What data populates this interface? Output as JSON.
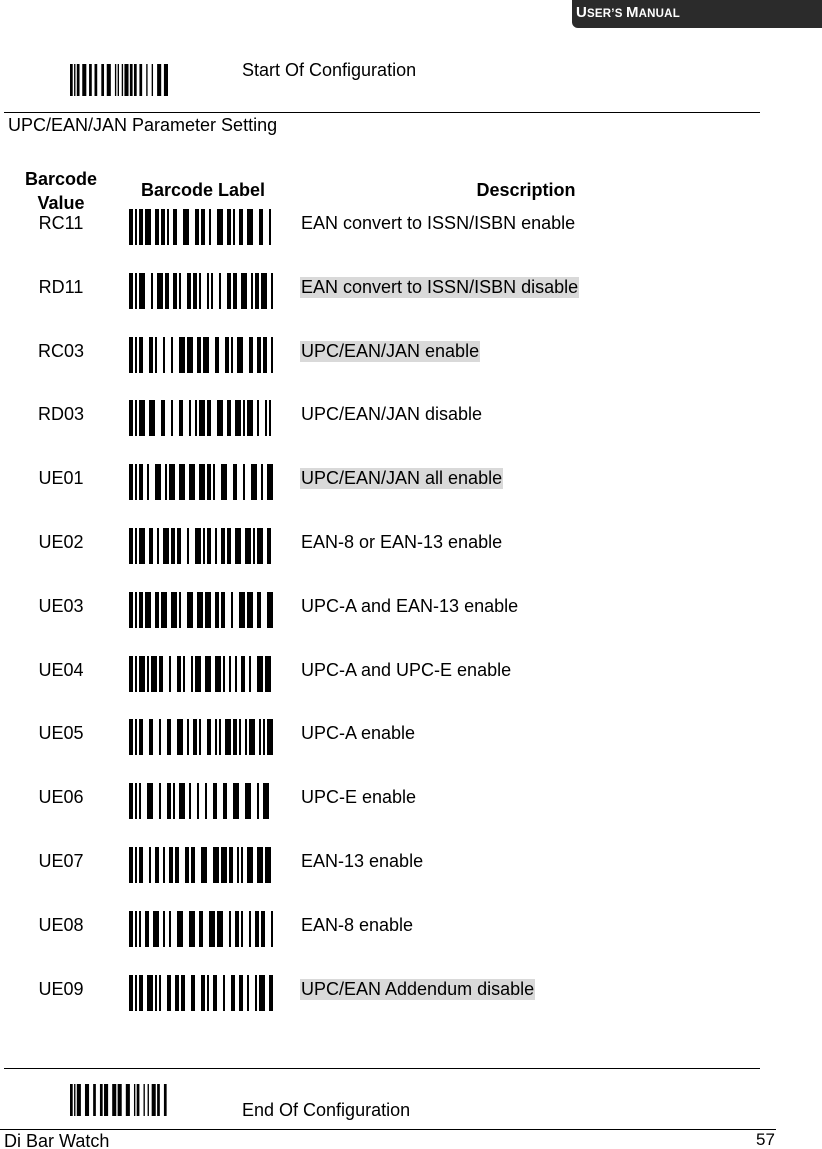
{
  "header": {
    "badge_first": "U",
    "badge_rest1": "SER’S ",
    "badge_first2": "M",
    "badge_rest2": "ANUAL"
  },
  "start_config": {
    "label": "Start Of Configuration",
    "icon": "barcode-icon"
  },
  "section_title": "UPC/EAN/JAN Parameter Setting",
  "table": {
    "headers": {
      "value_line1": "Barcode",
      "value_line2": "Value",
      "label": "Barcode Label",
      "description": "Description"
    },
    "rows": [
      {
        "value": "RC11",
        "description": "EAN convert to ISSN/ISBN enable",
        "highlighted": false
      },
      {
        "value": "RD11",
        "description": "EAN convert to ISSN/ISBN disable",
        "highlighted": true
      },
      {
        "value": "RC03",
        "description": "UPC/EAN/JAN enable",
        "highlighted": true
      },
      {
        "value": "RD03",
        "description": "UPC/EAN/JAN disable",
        "highlighted": false
      },
      {
        "value": "UE01",
        "description": "UPC/EAN/JAN all enable",
        "highlighted": true
      },
      {
        "value": "UE02",
        "description": "EAN-8 or EAN-13 enable",
        "highlighted": false
      },
      {
        "value": "UE03",
        "description": "UPC-A and EAN-13 enable",
        "highlighted": false
      },
      {
        "value": "UE04",
        "description": "UPC-A and UPC-E enable",
        "highlighted": false
      },
      {
        "value": "UE05",
        "description": "UPC-A enable",
        "highlighted": false
      },
      {
        "value": "UE06",
        "description": "UPC-E enable",
        "highlighted": false
      },
      {
        "value": "UE07",
        "description": "EAN-13 enable",
        "highlighted": false
      },
      {
        "value": "UE08",
        "description": "EAN-8 enable",
        "highlighted": false
      },
      {
        "value": "UE09",
        "description": "UPC/EAN Addendum disable",
        "highlighted": true
      }
    ]
  },
  "end_config": {
    "label": "End Of Configuration",
    "icon": "barcode-icon"
  },
  "footer": {
    "product": "Di Bar Watch",
    "page_number": "57"
  },
  "colors": {
    "badge_bg": "#2b2b2b",
    "highlight": "#d9d9d9"
  }
}
